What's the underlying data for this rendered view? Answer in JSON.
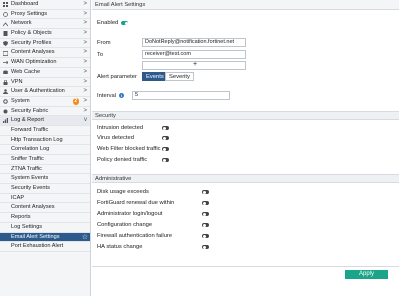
{
  "sidebar": {
    "items": [
      {
        "label": "Dashboard",
        "icon": "dashboard-icon",
        "arrow": ">"
      },
      {
        "label": "Proxy Settings",
        "icon": "proxy-icon",
        "arrow": ">"
      },
      {
        "label": "Network",
        "icon": "network-icon",
        "arrow": ">"
      },
      {
        "label": "Policy & Objects",
        "icon": "policy-icon",
        "arrow": ">"
      },
      {
        "label": "Security Profiles",
        "icon": "shield-icon",
        "arrow": ">"
      },
      {
        "label": "Content Analyses",
        "icon": "content-icon",
        "arrow": ">"
      },
      {
        "label": "WAN Optimization",
        "icon": "wan-icon",
        "arrow": ">"
      },
      {
        "label": "Web Cache",
        "icon": "cache-icon",
        "arrow": ">"
      },
      {
        "label": "VPN",
        "icon": "vpn-icon",
        "arrow": ">"
      },
      {
        "label": "User & Authentication",
        "icon": "user-icon",
        "arrow": ">"
      },
      {
        "label": "System",
        "icon": "gear-icon",
        "arrow": ">",
        "badge": "2"
      },
      {
        "label": "Security Fabric",
        "icon": "fabric-icon",
        "arrow": ">"
      },
      {
        "label": "Log & Report",
        "icon": "log-icon",
        "arrow": "v"
      }
    ],
    "subitems": [
      {
        "label": "Forward Traffic"
      },
      {
        "label": "Http Transaction Log"
      },
      {
        "label": "Correlation Log"
      },
      {
        "label": "Sniffer Traffic"
      },
      {
        "label": "ZTNA Traffic"
      },
      {
        "label": "System Events"
      },
      {
        "label": "Security Events"
      },
      {
        "label": "ICAP"
      },
      {
        "label": "Content Analyses"
      },
      {
        "label": "Reports"
      },
      {
        "label": "Log Settings"
      },
      {
        "label": "Email Alert Settings"
      },
      {
        "label": "Port Exhaustion Alert"
      }
    ]
  },
  "main": {
    "title": "Email Alert Settings",
    "enabled_label": "Enabled",
    "from_label": "From",
    "from_value": "DoNotReply@notification.fortinet.net",
    "to_label": "To",
    "to_value": "receiver@test.com",
    "add_symbol": "+",
    "alert_param_label": "Alert parameter",
    "tabs": [
      "Events",
      "Severity"
    ],
    "interval_label": "Interval",
    "info_symbol": "i",
    "interval_value": "5",
    "security_header": "Security",
    "security_items": [
      "Intrusion detected",
      "Virus detected",
      "Web Filter blocked traffic",
      "Policy denied traffic"
    ],
    "admin_header": "Administrative",
    "admin_items": [
      "Disk usage exceeds",
      "FortiGuard renewal due within",
      "Administrator login/logout",
      "Configuration change",
      "Firewall authentication failure",
      "HA status change"
    ],
    "apply_label": "Apply"
  },
  "colors": {
    "accent": "#1aa58a",
    "active_nav": "#2d5a8c",
    "badge": "#f28c18"
  }
}
